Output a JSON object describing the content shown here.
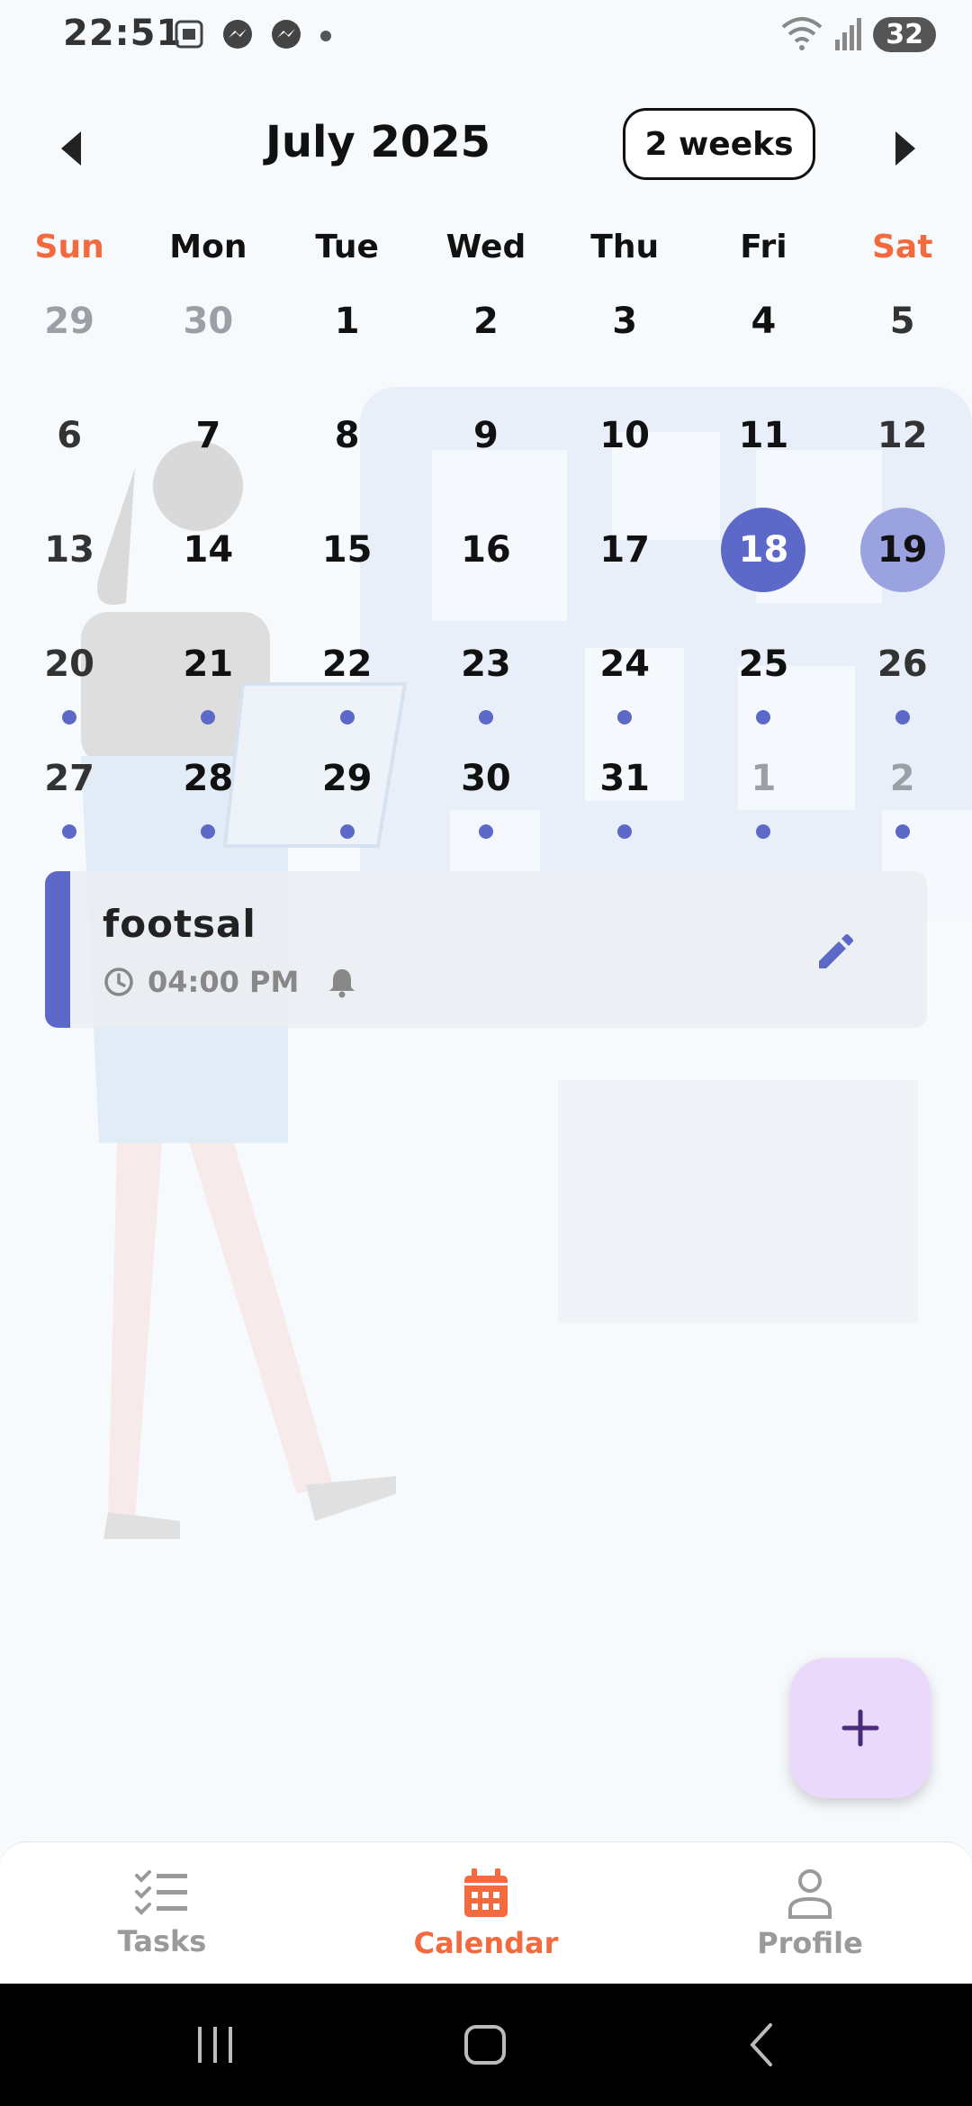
{
  "status_bar": {
    "time": "22:51",
    "battery": "32",
    "icons": [
      "screenshot-icon",
      "messenger-icon",
      "messenger-icon",
      "dot-icon",
      "wifi-icon",
      "signal-icon"
    ]
  },
  "header": {
    "month_title": "July 2025",
    "range_button": "2 weeks"
  },
  "calendar": {
    "weekdays": [
      "Sun",
      "Mon",
      "Tue",
      "Wed",
      "Thu",
      "Fri",
      "Sat"
    ],
    "weeks": [
      [
        "29",
        "30",
        "1",
        "2",
        "3",
        "4",
        "5"
      ],
      [
        "6",
        "7",
        "8",
        "9",
        "10",
        "11",
        "12"
      ],
      [
        "13",
        "14",
        "15",
        "16",
        "17",
        "18",
        "19"
      ],
      [
        "20",
        "21",
        "22",
        "23",
        "24",
        "25",
        "26"
      ],
      [
        "27",
        "28",
        "29",
        "30",
        "31",
        "1",
        "2"
      ]
    ],
    "today": "18",
    "selected": "19"
  },
  "event": {
    "title": "footsal",
    "time": "04:00 PM"
  },
  "nav": {
    "tasks": "Tasks",
    "calendar": "Calendar",
    "profile": "Profile"
  },
  "colors": {
    "accent": "#5c69c9",
    "accent_light": "#9aa3e0",
    "orange": "#f26a3d",
    "fab_bg": "#ead9fb"
  }
}
